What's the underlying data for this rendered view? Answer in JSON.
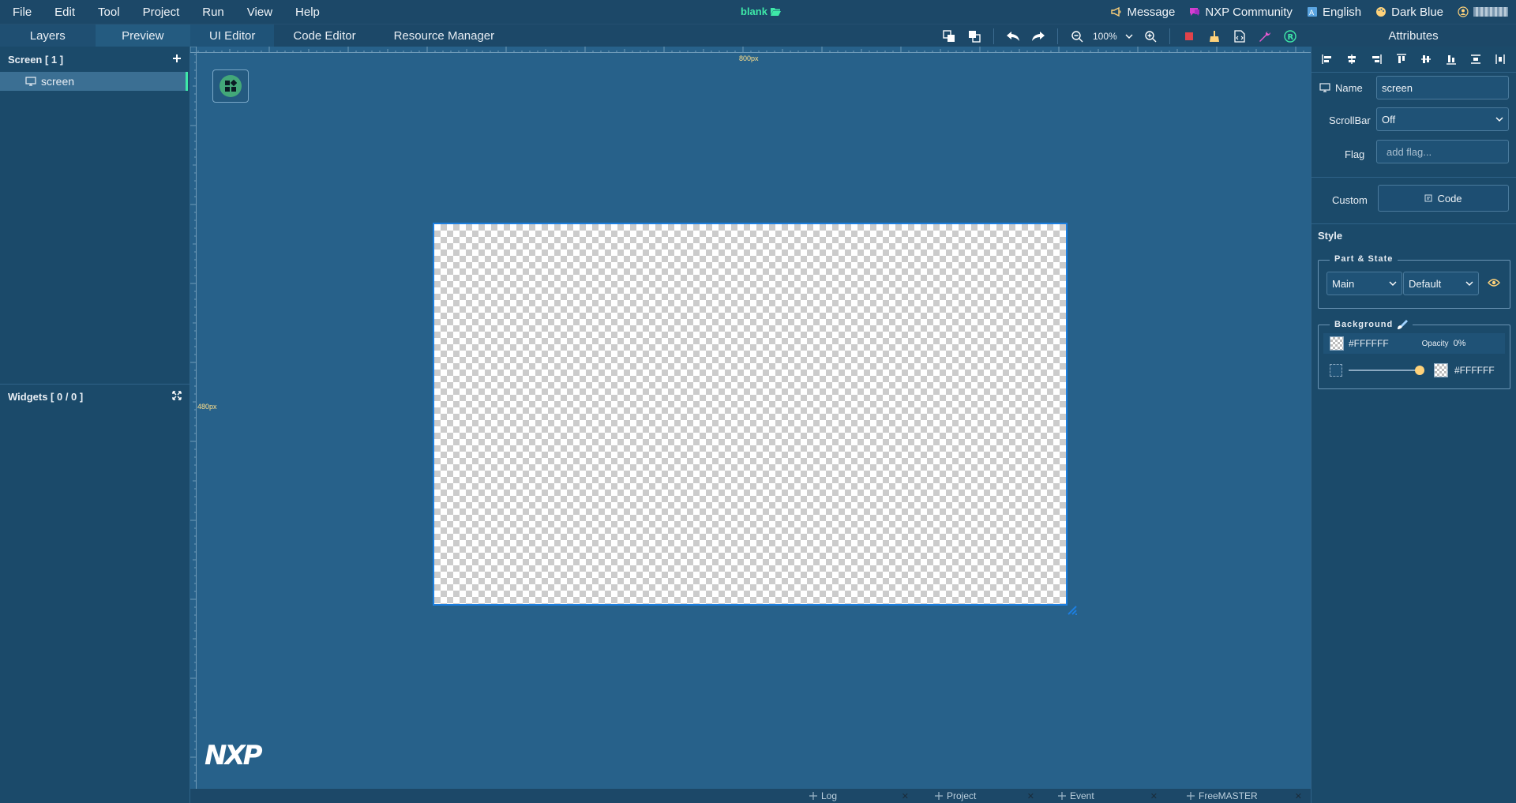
{
  "menubar": {
    "items": [
      "File",
      "Edit",
      "Tool",
      "Project",
      "Run",
      "View",
      "Help"
    ],
    "project_title": "blank",
    "right": {
      "message": "Message",
      "community": "NXP Community",
      "language": "English",
      "theme": "Dark Blue"
    }
  },
  "tabs": {
    "left": [
      "Layers",
      "Preview"
    ],
    "editor": [
      "UI Editor",
      "Code Editor",
      "Resource Manager"
    ],
    "zoom": "100%",
    "attributes_title": "Attributes"
  },
  "layers": {
    "screen_header": "Screen [ 1 ]",
    "screen_item": "screen",
    "widgets_header": "Widgets [ 0 / 0 ]"
  },
  "canvas": {
    "ruler_width_label": "800px",
    "ruler_height_label": "480px",
    "logo": "NXP"
  },
  "bottom_tabs": [
    "Log",
    "Project",
    "Event",
    "FreeMASTER"
  ],
  "attributes": {
    "name_label": "Name",
    "name_value": "screen",
    "scrollbar_label": "ScrollBar",
    "scrollbar_value": "Off",
    "flag_label": "Flag",
    "flag_placeholder": "add flag...",
    "custom_label": "Custom",
    "code_button": "Code",
    "style_label": "Style",
    "part_state_legend": "Part & State",
    "part_value": "Main",
    "state_value": "Default",
    "background_legend": "Background",
    "bg_color": "#FFFFFF",
    "opacity_label": "Opacity",
    "opacity_value": "0%",
    "grad_color": "#FFFFFF"
  },
  "colors": {
    "accent": "#3ee8a8",
    "canvas_border": "#1c7fe0",
    "panel_bg": "#1b4a6a",
    "workspace_bg": "#27618a"
  }
}
